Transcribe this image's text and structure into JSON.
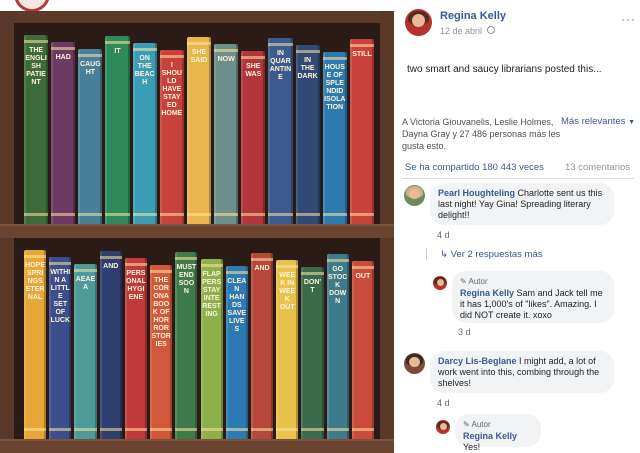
{
  "books_top": [
    {
      "title": "The English Patient",
      "color": "#3d6b3a"
    },
    {
      "title": "Had",
      "color": "#6c3a63"
    },
    {
      "title": "Caught",
      "color": "#4a7f9a"
    },
    {
      "title": "It",
      "color": "#2e8a5a"
    },
    {
      "title": "On the Beach",
      "color": "#3b9db5"
    },
    {
      "title": "I Should Have Stayed Home",
      "color": "#c8423b"
    },
    {
      "title": "She Said",
      "color": "#e8b64b"
    },
    {
      "title": "Now",
      "color": "#6d8f8b"
    },
    {
      "title": "She Was",
      "color": "#b2353b"
    },
    {
      "title": "In Quarantine",
      "color": "#3b5a8e"
    },
    {
      "title": "In The Dark",
      "color": "#2f4a74"
    },
    {
      "title": "House of Splendid Isolation",
      "color": "#2b7bb0"
    },
    {
      "title": "Still",
      "color": "#c8423b"
    }
  ],
  "books_bottom": [
    {
      "title": "Hope Springs Eternal",
      "color": "#e6a63a"
    },
    {
      "title": "Within a Little Set of Luck",
      "color": "#3a4f8c"
    },
    {
      "title": "Aeaea",
      "color": "#4c9a9a"
    },
    {
      "title": "And",
      "color": "#2e3f6e"
    },
    {
      "title": "Personal Hygiene",
      "color": "#c0393b"
    },
    {
      "title": "The Corona Book of Horror Stories",
      "color": "#d2583b"
    },
    {
      "title": "Must End Soon",
      "color": "#3f7a4a"
    },
    {
      "title": "Flappers Stay Interesting",
      "color": "#8cb04a"
    },
    {
      "title": "Clean Hands Save Lives",
      "color": "#2e7bb4"
    },
    {
      "title": "And",
      "color": "#b8473b"
    },
    {
      "title": "Week in Week Out",
      "color": "#e8c24b"
    },
    {
      "title": "Don't",
      "color": "#3a6a4a"
    },
    {
      "title": "Go Stock Down",
      "color": "#3d7a8a"
    },
    {
      "title": "Out",
      "color": "#c94b3b"
    }
  ],
  "post": {
    "author": "Regina Kelly",
    "date": "12 de abril",
    "more_glyph": "···",
    "text": "two smart and saucy librarians posted this...",
    "reactions_summary": "A Victoria Giouvanelis, Leslie Holmes, Dayna Gray y 27 486 personas más les gusta esto.",
    "sort_label": "Más relevantes",
    "shares": "Se ha compartido 180 443 veces",
    "comment_count": "13 comentarios"
  },
  "comments": [
    {
      "name": "Pearl Houghteling",
      "text": "Charlotte sent us this last night! Yay Gina! Spreading literary delight!!",
      "time": "4 d",
      "avatar_color": "#6d8a5a"
    },
    {
      "name": "Regina Kelly",
      "badge": "Autor",
      "text": "Sam and Jack tell me it has 1,000's of \"likes\". Amazing. I did NOT create it. xoxo",
      "time": "3 d",
      "avatar_color": "#b3322b"
    },
    {
      "name": "Darcy Lis-Beglane",
      "text": "I might add, a lot of work went into this, combing through the shelves!",
      "time": "4 d",
      "avatar_color": "#7a4a3a"
    },
    {
      "name": "Regina Kelly",
      "badge": "Autor",
      "text": "Yes!",
      "time": "",
      "avatar_color": "#b3322b"
    }
  ],
  "replies_link": "Ver 2 respuestas más"
}
